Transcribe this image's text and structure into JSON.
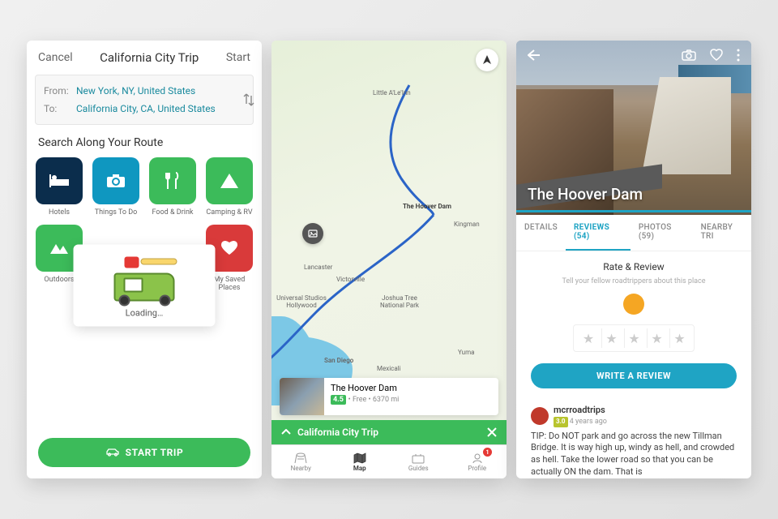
{
  "screen1": {
    "cancel": "Cancel",
    "title": "California City Trip",
    "start": "Start",
    "from_label": "From:",
    "from_value": "New York, NY, United States",
    "to_label": "To:",
    "to_value": "California City, CA, United States",
    "search_heading": "Search Along Your Route",
    "categories": [
      {
        "label": "Hotels",
        "color": "#0b2d4c",
        "icon": "bed"
      },
      {
        "label": "Things To Do",
        "color": "#0f97c0",
        "icon": "camera"
      },
      {
        "label": "Food & Drink",
        "color": "#3cbb5a",
        "icon": "food"
      },
      {
        "label": "Camping & RV",
        "color": "#3cbb5a",
        "icon": "tent"
      },
      {
        "label": "Outdoors",
        "color": "#3cbb5a",
        "icon": "mountain"
      },
      {
        "label": "",
        "color": "transparent",
        "icon": ""
      },
      {
        "label": "",
        "color": "transparent",
        "icon": ""
      },
      {
        "label": "My Saved Places",
        "color": "#d93a3a",
        "icon": "heart"
      }
    ],
    "loading_text": "Loading…",
    "start_trip_btn": "START TRIP"
  },
  "screen2": {
    "map_labels": {
      "ale_inn": "Little A'Le'Inn",
      "hoover": "The Hoover Dam",
      "lancaster": "Lancaster",
      "victorville": "Victorville",
      "kingman": "Kingman",
      "universal": "Universal Studios Hollywood",
      "joshua": "Joshua Tree National Park",
      "sandiego": "San Diego",
      "mexicali": "Mexicali",
      "yuma": "Yuma"
    },
    "card": {
      "title": "The Hoover Dam",
      "rating": "4.5",
      "meta": "• Free • 6370 mi"
    },
    "tripbar": {
      "title": "California City Trip"
    },
    "tabs": [
      {
        "label": "Nearby"
      },
      {
        "label": "Map"
      },
      {
        "label": "Guides"
      },
      {
        "label": "Profile",
        "badge": "1"
      }
    ]
  },
  "screen3": {
    "title": "The Hoover Dam",
    "tabs": {
      "details": "DETAILS",
      "reviews": "REVIEWS (54)",
      "photos": "PHOTOS (59)",
      "nearby": "NEARBY TRI"
    },
    "rate_heading": "Rate & Review",
    "rate_sub": "Tell your fellow roadtrippers about this place",
    "write_btn": "WRITE A REVIEW",
    "review": {
      "user": "mcrroadtrips",
      "rating": "3.0",
      "time": "4 years ago",
      "text": "TIP: Do NOT park and go across the new Tillman Bridge. It is way high up, windy as hell, and crowded as hell. Take the lower road so that you can be actually ON the dam. That is"
    }
  }
}
